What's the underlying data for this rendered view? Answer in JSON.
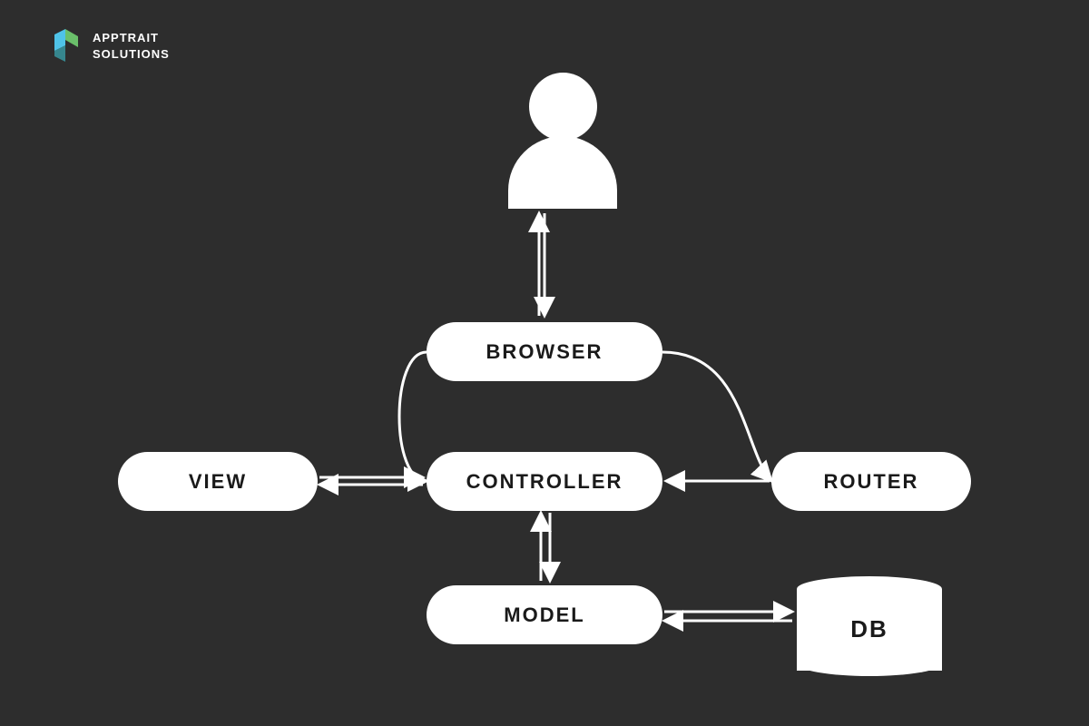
{
  "logo": {
    "company_line1": "APPTRAIT",
    "company_line2": "SOLUTIONS"
  },
  "diagram": {
    "nodes": {
      "browser": "BROWSER",
      "controller": "CONTROLLER",
      "view": "VIEW",
      "router": "ROUTER",
      "model": "MODEL",
      "db": "DB"
    },
    "bg_color": "#2d2d2d"
  }
}
